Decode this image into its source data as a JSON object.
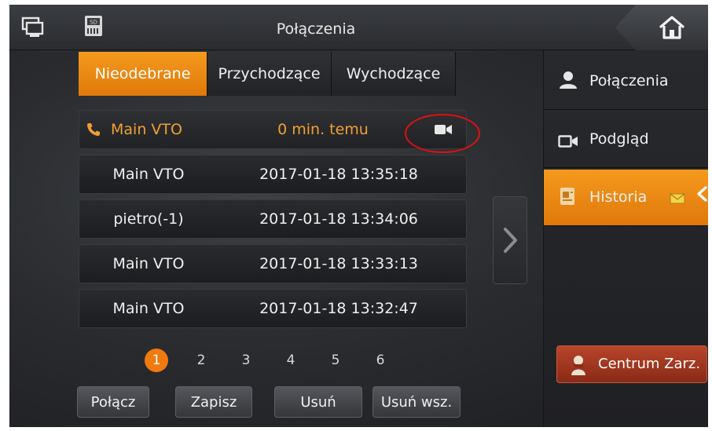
{
  "header": {
    "title": "Połączenia",
    "left_icons": [
      "monitor-icon",
      "sd-card-icon"
    ],
    "home_icon": "home-icon"
  },
  "tabs": [
    {
      "label": "Nieodebrane",
      "active": true
    },
    {
      "label": "Przychodzące",
      "active": false
    },
    {
      "label": "Wychodzące",
      "active": false
    }
  ],
  "records": [
    {
      "name": "Main VTO",
      "time": "0 min. temu",
      "icon": "phone-icon",
      "media": "video-icon",
      "highlighted": true
    },
    {
      "name": "Main VTO",
      "time": "2017-01-18 13:35:18"
    },
    {
      "name": "pietro(-1)",
      "time": "2017-01-18 13:34:06"
    },
    {
      "name": "Main VTO",
      "time": "2017-01-18 13:33:13"
    },
    {
      "name": "Main VTO",
      "time": "2017-01-18 13:32:47"
    }
  ],
  "pagination": {
    "pages": [
      "1",
      "2",
      "3",
      "4",
      "5",
      "6"
    ],
    "current": "1"
  },
  "buttons": {
    "connect": "Połącz",
    "save": "Zapisz",
    "delete": "Usuń",
    "delete_all": "Usuń wsz."
  },
  "sidebar": {
    "items": [
      {
        "label": "Połączenia",
        "icon": "user-icon"
      },
      {
        "label": "Podgląd",
        "icon": "camera-icon"
      },
      {
        "label": "Historia",
        "icon": "history-icon",
        "active": true
      }
    ],
    "centrum_label": "Centrum Zarz."
  },
  "colors": {
    "accent": "#f08a14",
    "annotation": "#e01010",
    "centrum": "#a63a22"
  }
}
